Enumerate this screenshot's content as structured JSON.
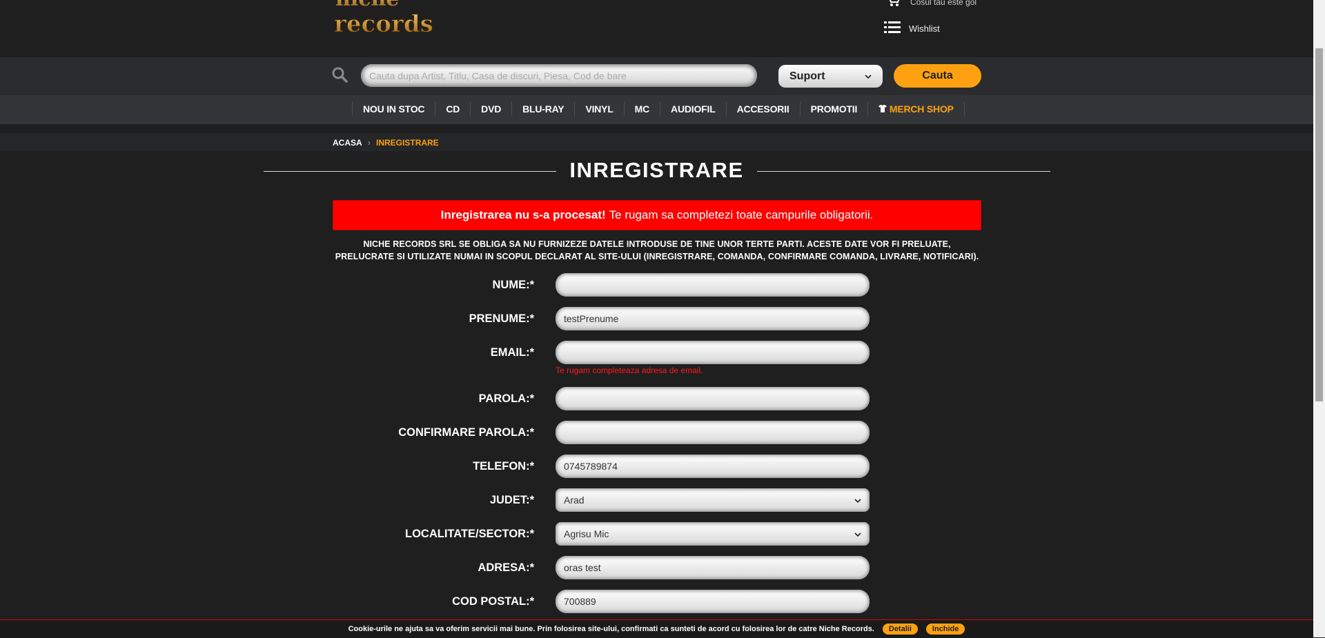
{
  "brand": {
    "logo_alt": "Niche Records"
  },
  "header": {
    "cart_text": "Cosul tau este gol",
    "wishlist_label": "Wishlist"
  },
  "search": {
    "placeholder": "Cauta dupa Artist, Titlu, Casa de discuri, Piesa, Cod de bare",
    "support_selected": "Suport",
    "button_label": "Cauta"
  },
  "nav": {
    "items": [
      "NOU IN STOC",
      "CD",
      "DVD",
      "BLU-RAY",
      "VINYL",
      "MC",
      "AUDIOFIL",
      "ACCESORII",
      "PROMOTII"
    ],
    "merch_label": "MERCH SHOP"
  },
  "breadcrumb": {
    "home": "ACASA",
    "current": "INREGISTRARE"
  },
  "page": {
    "title": "INREGISTRARE",
    "alert_bold": "Inregistrarea nu s-a procesat!",
    "alert_text": "Te rugam sa completezi toate campurile obligatorii.",
    "notice": "NICHE RECORDS SRL SE OBLIGA SA NU FURNIZEZE DATELE INTRODUSE DE TINE UNOR TERTE PARTI. ACESTE DATE VOR FI PRELUATE, PRELUCRATE SI UTILIZATE NUMAI IN SCOPUL DECLARAT AL SITE-ULUI (INREGISTRARE, COMANDA, CONFIRMARE COMANDA, LIVRARE, NOTIFICARI)."
  },
  "form": {
    "nume": {
      "label": "NUME:*",
      "value": ""
    },
    "prenume": {
      "label": "PRENUME:*",
      "value": "testPrenume"
    },
    "email": {
      "label": "EMAIL:*",
      "value": "",
      "error": "Te rugam completeaza adresa de email."
    },
    "parola": {
      "label": "PAROLA:*",
      "value": ""
    },
    "confirmare": {
      "label": "CONFIRMARE PAROLA:*",
      "value": ""
    },
    "telefon": {
      "label": "TELEFON:*",
      "value": "0745789874"
    },
    "judet": {
      "label": "JUDET:*",
      "value": "Arad"
    },
    "localitate": {
      "label": "LOCALITATE/SECTOR:*",
      "value": "Agrisu Mic"
    },
    "adresa": {
      "label": "ADRESA:*",
      "value": "oras test"
    },
    "cod_postal": {
      "label": "COD POSTAL:*",
      "value": "700889"
    }
  },
  "cookie": {
    "text": "Cookie-urile ne ajuta sa va oferim servicii mai bune. Prin folosirea site-ului, confirmati ca sunteti de acord cu folosirea lor de catre Niche Records.",
    "details_label": "Detalii",
    "close_label": "Inchide"
  },
  "colors": {
    "accent": "#fda110",
    "alert": "#ff0000",
    "background": "#1f1f20"
  }
}
